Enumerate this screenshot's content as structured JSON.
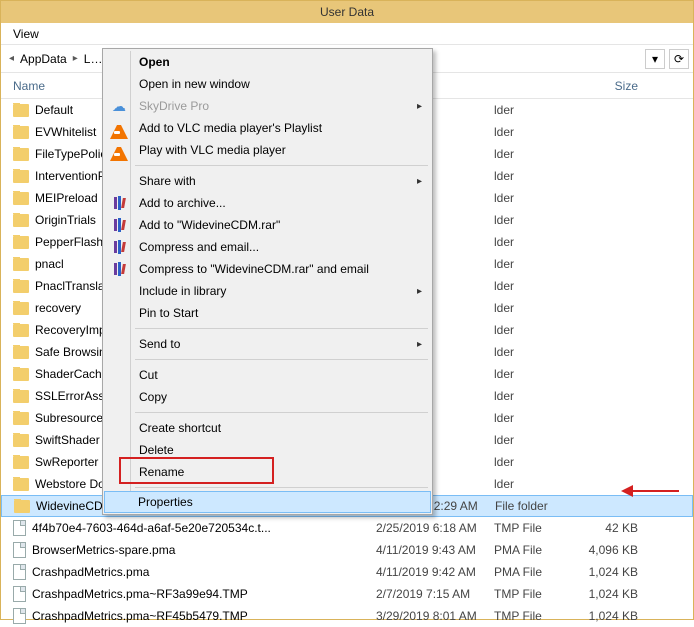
{
  "window": {
    "title": "User Data"
  },
  "menu": {
    "view": "View"
  },
  "breadcrumb": {
    "item1": "AppData",
    "item2": "L…"
  },
  "columns": {
    "name": "Name",
    "date": "",
    "type": "",
    "size": "Size"
  },
  "context_menu": {
    "open": "Open",
    "open_new_window": "Open in new window",
    "skydrive_pro": "SkyDrive Pro",
    "add_vlc_playlist": "Add to VLC media player's Playlist",
    "play_vlc": "Play with VLC media player",
    "share_with": "Share with",
    "add_archive": "Add to archive...",
    "add_rar": "Add to \"WidevineCDM.rar\"",
    "compress_email": "Compress and email...",
    "compress_rar_email": "Compress to \"WidevineCDM.rar\" and email",
    "include_library": "Include in library",
    "pin_start": "Pin to Start",
    "send_to": "Send to",
    "cut": "Cut",
    "copy": "Copy",
    "create_shortcut": "Create shortcut",
    "delete": "Delete",
    "rename": "Rename",
    "properties": "Properties"
  },
  "files": {
    "r0": {
      "name": "Default",
      "type_tail": "lder"
    },
    "r1": {
      "name": "EVWhitelist",
      "type_tail": "lder"
    },
    "r2": {
      "name": "FileTypePolici",
      "type_tail": "lder"
    },
    "r3": {
      "name": "InterventionP",
      "type_tail": "lder"
    },
    "r4": {
      "name": "MEIPreload",
      "type_tail": "lder"
    },
    "r5": {
      "name": "OriginTrials",
      "type_tail": "lder"
    },
    "r6": {
      "name": "PepperFlash",
      "type_tail": "lder"
    },
    "r7": {
      "name": "pnacl",
      "type_tail": "lder"
    },
    "r8": {
      "name": "PnaclTranslatio",
      "type_tail": "lder"
    },
    "r9": {
      "name": "recovery",
      "type_tail": "lder"
    },
    "r10": {
      "name": "RecoveryImpr",
      "type_tail": "lder"
    },
    "r11": {
      "name": "Safe Browsing",
      "type_tail": "lder"
    },
    "r12": {
      "name": "ShaderCache",
      "type_tail": "lder"
    },
    "r13": {
      "name": "SSLErrorAssist",
      "type_tail": "lder"
    },
    "r14": {
      "name": "Subresource F",
      "type_tail": "lder"
    },
    "r15": {
      "name": "SwiftShader",
      "type_tail": "lder"
    },
    "r16": {
      "name": "SwReporter",
      "type_tail": "lder"
    },
    "r17": {
      "name": "Webstore Dow",
      "type_tail": "lder"
    },
    "r18": {
      "name": "WidevineCDM",
      "date": "1/1/2015 12:29 AM",
      "type": "File folder",
      "size": ""
    },
    "r19": {
      "name": "4f4b70e4-7603-464d-a6af-5e20e720534c.t...",
      "date": "2/25/2019 6:18 AM",
      "type": "TMP File",
      "size": "42 KB"
    },
    "r20": {
      "name": "BrowserMetrics-spare.pma",
      "date": "4/11/2019 9:43 AM",
      "type": "PMA File",
      "size": "4,096 KB"
    },
    "r21": {
      "name": "CrashpadMetrics.pma",
      "date": "4/11/2019 9:42 AM",
      "type": "PMA File",
      "size": "1,024 KB"
    },
    "r22": {
      "name": "CrashpadMetrics.pma~RF3a99e94.TMP",
      "date": "2/7/2019 7:15 AM",
      "type": "TMP File",
      "size": "1,024 KB"
    },
    "r23": {
      "name": "CrashpadMetrics.pma~RF45b5479.TMP",
      "date": "3/29/2019 8:01 AM",
      "type": "TMP File",
      "size": "1,024 KB"
    }
  }
}
